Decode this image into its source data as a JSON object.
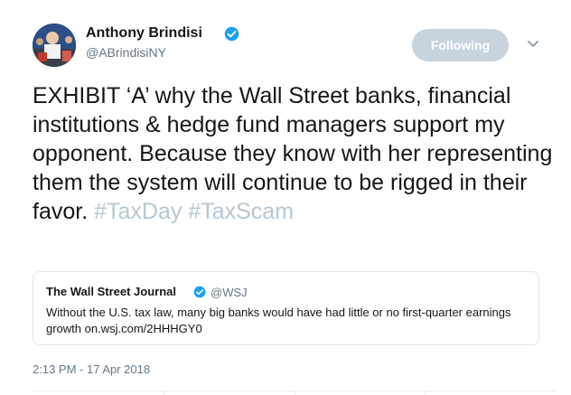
{
  "author": {
    "name": "Anthony Brindisi",
    "handle": "@ABrindisiNY",
    "avatar_icon": "profile-photo",
    "verified_icon": "verified-badge-icon"
  },
  "follow_button": {
    "label": "Following"
  },
  "menu": {
    "icon": "chevron-down-icon"
  },
  "tweet": {
    "text": "EXHIBIT ‘A’ why the Wall Street banks, financial institutions & hedge fund managers support my opponent. Because they know with her representing them the system will continue to be rigged in their favor. ",
    "hashtags": [
      "#TaxDay",
      "#TaxScam"
    ],
    "timestamp": "2:13 PM - 17 Apr 2018"
  },
  "quoted_tweet": {
    "name": "The Wall Street Journal",
    "handle": "@WSJ",
    "text": "Without the U.S. tax law, many big banks would have had little or no first-quarter earnings growth on.wsj.com/2HHHGY0"
  },
  "colors": {
    "verified": "#1da1f2",
    "following_button_bg": "#c8d4dd",
    "hashtag": "#b6c7d3",
    "secondary_text": "#657786"
  }
}
